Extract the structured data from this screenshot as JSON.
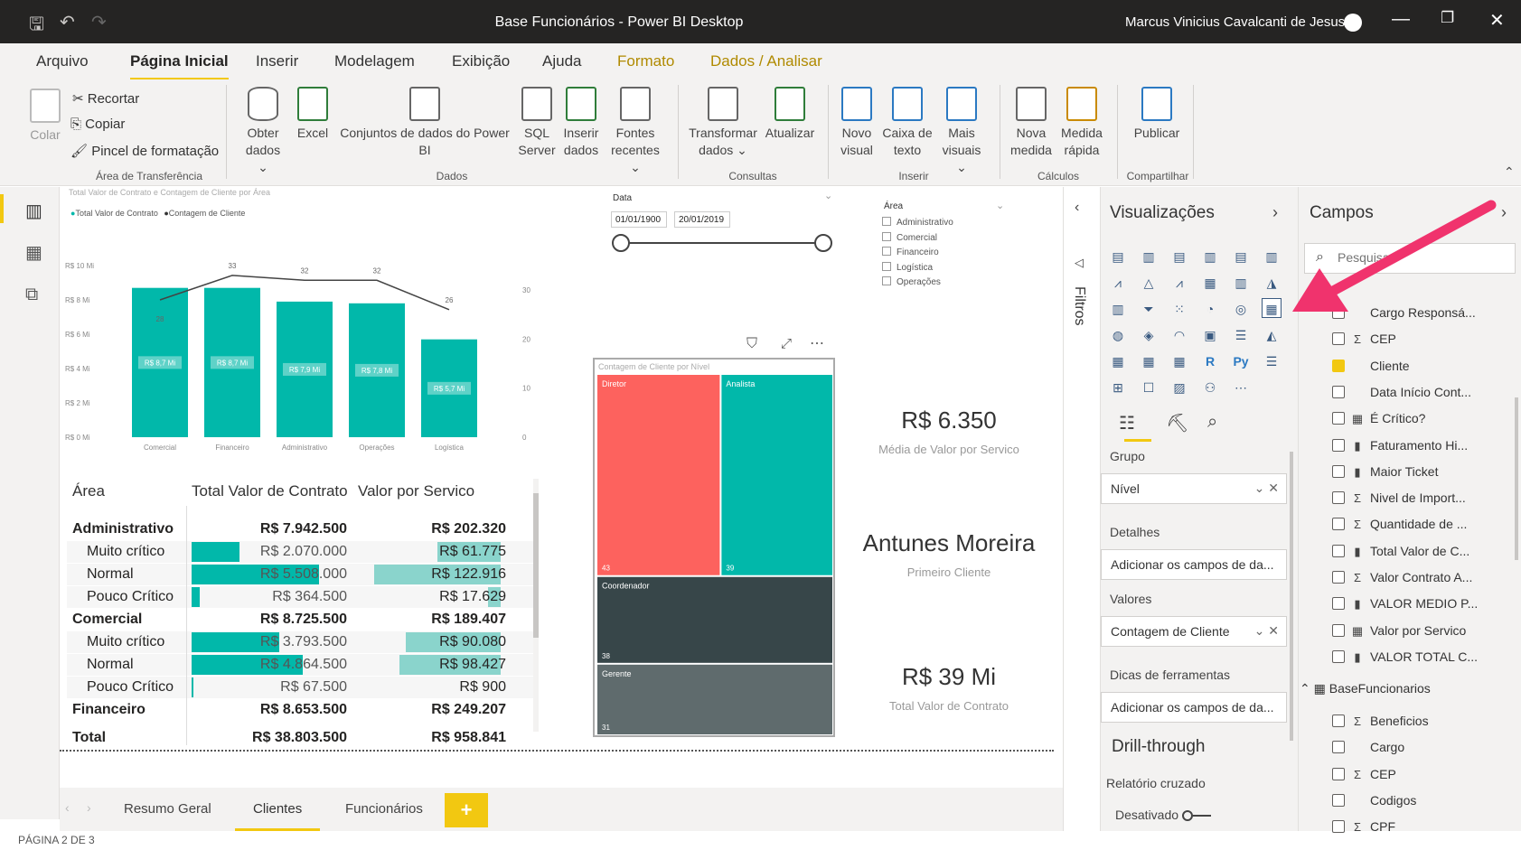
{
  "window": {
    "title": "Base Funcionários - Power BI Desktop",
    "user": "Marcus Vinicius Cavalcanti de Jesus"
  },
  "menu": [
    "Arquivo",
    "Página Inicial",
    "Inserir",
    "Modelagem",
    "Exibição",
    "Ajuda",
    "Formato",
    "Dados / Analisar"
  ],
  "ribbon": {
    "colar": "Colar",
    "recortar": "Recortar",
    "copiar": "Copiar",
    "pincel": "Pincel de formatação",
    "obter": "Obter dados",
    "excel": "Excel",
    "conjuntos": "Conjuntos de dados do Power BI",
    "sql": "SQL Server",
    "inserir_dados": "Inserir dados",
    "fontes": "Fontes recentes",
    "transformar": "Transformar dados",
    "atualizar": "Atualizar",
    "novo_visual": "Novo visual",
    "caixa_texto": "Caixa de texto",
    "mais_visuais": "Mais visuais",
    "nova_medida": "Nova medida",
    "medida_rapida": "Medida rápida",
    "publicar": "Publicar",
    "groups": {
      "transfer": "Área de Transferência",
      "dados": "Dados",
      "consultas": "Consultas",
      "inserir": "Inserir",
      "calculos": "Cálculos",
      "compartilhar": "Compartilhar"
    }
  },
  "chart_data": [
    {
      "type": "bar",
      "title": "Total Valor de Contrato e Contagem de Cliente por Área",
      "legend": [
        "Total Valor de Contrato",
        "Contagem de Cliente"
      ],
      "categories": [
        "Comercial",
        "Financeiro",
        "Administrativo",
        "Operações",
        "Logística"
      ],
      "series": [
        {
          "name": "Total Valor de Contrato",
          "values": [
            8.7,
            8.7,
            7.9,
            7.8,
            5.7
          ],
          "labels": [
            "R$ 8,7 Mi",
            "R$ 8,7 Mi",
            "R$ 7,9 Mi",
            "R$ 7,8 Mi",
            "R$ 5,7 Mi"
          ]
        },
        {
          "name": "Contagem de Cliente",
          "values": [
            28,
            33,
            32,
            32,
            26
          ]
        }
      ],
      "yticks": [
        "R$ 10 Mi",
        "R$ 8 Mi",
        "R$ 6 Mi",
        "R$ 4 Mi",
        "R$ 2 Mi",
        "R$ 0 Mi"
      ],
      "ylim": [
        0,
        10
      ],
      "y2ticks": [
        "30",
        "20",
        "10",
        "0"
      ],
      "y2lim": [
        0,
        35
      ]
    },
    {
      "type": "treemap",
      "title": "Contagem de Cliente por Nível",
      "categories": [
        "Diretor",
        "Analista",
        "Coordenador",
        "Gerente"
      ],
      "values": [
        43,
        39,
        38,
        31
      ]
    }
  ],
  "slicer_data": {
    "label": "Data",
    "from": "01/01/1900",
    "to": "20/01/2019"
  },
  "slicer_area": {
    "label": "Área",
    "items": [
      "Administrativo",
      "Comercial",
      "Financeiro",
      "Logística",
      "Operações"
    ]
  },
  "table": {
    "headers": [
      "Área",
      "Total Valor de Contrato",
      "Valor por Servico"
    ],
    "rows": [
      {
        "label": "Administrativo",
        "v": "R$ 7.942.500",
        "s": "R$ 202.320",
        "bold": true
      },
      {
        "label": "Muito crítico",
        "v": "R$ 2.070.000",
        "s": "R$ 61.775",
        "bar": 0.3,
        "bar3": 0.5
      },
      {
        "label": "Normal",
        "v": "R$ 5.508.000",
        "s": "R$ 122.916",
        "bar": 0.8,
        "bar3": 1
      },
      {
        "label": "Pouco Crítico",
        "v": "R$ 364.500",
        "s": "R$ 17.629",
        "bar": 0.05,
        "bar3": 0.1
      },
      {
        "label": "Comercial",
        "v": "R$ 8.725.500",
        "s": "R$ 189.407",
        "bold": true
      },
      {
        "label": "Muito crítico",
        "v": "R$ 3.793.500",
        "s": "R$ 90.080",
        "bar": 0.55,
        "bar3": 0.75
      },
      {
        "label": "Normal",
        "v": "R$ 4.864.500",
        "s": "R$ 98.427",
        "bar": 0.7,
        "bar3": 0.8
      },
      {
        "label": "Pouco Crítico",
        "v": "R$ 67.500",
        "s": "R$ 900",
        "bar": 0.01,
        "bar3": 0
      },
      {
        "label": "Financeiro",
        "v": "R$ 8.653.500",
        "s": "R$ 249.207",
        "bold": true
      }
    ],
    "total": {
      "label": "Total",
      "v": "R$ 38.803.500",
      "s": "R$ 958.841"
    }
  },
  "cards": [
    {
      "value": "R$ 6.350",
      "label": "Média de Valor por Servico"
    },
    {
      "value": "Antunes Moreira",
      "label": "Primeiro Cliente"
    },
    {
      "value": "R$ 39 Mi",
      "label": "Total Valor de Contrato"
    }
  ],
  "tabs": [
    "Resumo Geral",
    "Clientes",
    "Funcionários"
  ],
  "status": "PÁGINA 2 DE 3",
  "filters_label": "Filtros",
  "viz": {
    "title": "Visualizações",
    "grupo": "Grupo",
    "nivel": "Nível",
    "detalhes": "Detalhes",
    "add": "Adicionar os campos de da...",
    "valores": "Valores",
    "contagem": "Contagem de Cliente",
    "dicas": "Dicas de ferramentas",
    "drill": "Drill-through",
    "relatorio": "Relatório cruzado",
    "desativado": "Desativado"
  },
  "fields": {
    "title": "Campos",
    "search_placeholder": "Pesquisar",
    "items": [
      {
        "name": "Cargo Responsá...",
        "sig": "",
        "checked": false
      },
      {
        "name": "CEP",
        "sig": "Σ",
        "checked": false
      },
      {
        "name": "Cliente",
        "sig": "",
        "checked": true
      },
      {
        "name": "Data Início Cont...",
        "sig": "",
        "checked": false
      },
      {
        "name": "É Crítico?",
        "sig": "▦",
        "checked": false
      },
      {
        "name": "Faturamento Hi...",
        "sig": "▮",
        "checked": false
      },
      {
        "name": "Maior Ticket",
        "sig": "▮",
        "checked": false
      },
      {
        "name": "Nivel de Import...",
        "sig": "Σ",
        "checked": false
      },
      {
        "name": "Quantidade de ...",
        "sig": "Σ",
        "checked": false
      },
      {
        "name": "Total Valor de C...",
        "sig": "▮",
        "checked": false
      },
      {
        "name": "Valor Contrato A...",
        "sig": "Σ",
        "checked": false
      },
      {
        "name": "VALOR MEDIO P...",
        "sig": "▮",
        "checked": false
      },
      {
        "name": "Valor por Servico",
        "sig": "▦",
        "checked": false
      },
      {
        "name": "VALOR TOTAL C...",
        "sig": "▮",
        "checked": false
      }
    ],
    "table2": "BaseFuncionarios",
    "items2": [
      {
        "name": "Beneficios",
        "sig": "Σ"
      },
      {
        "name": "Cargo",
        "sig": ""
      },
      {
        "name": "CEP",
        "sig": "Σ"
      },
      {
        "name": "Codigos",
        "sig": ""
      },
      {
        "name": "CPF",
        "sig": "Σ"
      }
    ]
  },
  "colors": {
    "teal": "#01b8aa",
    "red": "#fd625e",
    "dark": "#374649",
    "gray": "#5f6b6d",
    "yellow": "#f2c811",
    "arrow": "#f0336d"
  }
}
